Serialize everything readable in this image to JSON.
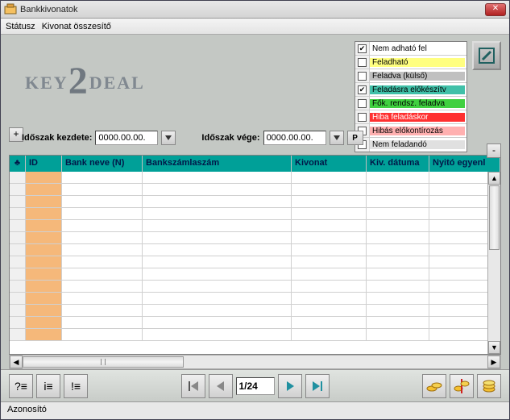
{
  "window": {
    "title": "Bankkivonatok"
  },
  "menu": {
    "status": "Státusz",
    "summary": "Kivonat összesítő"
  },
  "logo": {
    "left": "KEY",
    "mid": "2",
    "right": "DEAL"
  },
  "status_rows": [
    {
      "checked": true,
      "label": "Nem adható fel",
      "bg": "#ffffff"
    },
    {
      "checked": false,
      "label": "Feladható",
      "bg": "#ffff80"
    },
    {
      "checked": false,
      "label": "Feladva (külső)",
      "bg": "#c0c0c0"
    },
    {
      "checked": true,
      "label": "Feladásra előkészítv",
      "bg": "#40c0a8"
    },
    {
      "checked": false,
      "label": "Fők. rendsz. feladva",
      "bg": "#40d040"
    },
    {
      "checked": false,
      "label": "Hiba feladáskor",
      "bg": "#ff3030",
      "fg": "#fff"
    },
    {
      "checked": false,
      "label": "Hibás előkontírozás",
      "bg": "#ffb0b0"
    },
    {
      "checked": false,
      "label": "Nem feladandó",
      "bg": "#e0e0e0"
    }
  ],
  "dates": {
    "start_label": "Időszak kezdete:",
    "start_value": "0000.00.00.",
    "end_label": "Időszak vége:",
    "end_value": "0000.00.00.",
    "p_btn": "P"
  },
  "grid": {
    "columns": [
      "♣",
      "ID",
      "Bank neve (N)",
      "Bankszámlaszám",
      "Kivonat",
      "Kiv. dátuma",
      "Nyitó egyenl"
    ],
    "rows": 14
  },
  "nav": {
    "page": "1/24"
  },
  "statusbar": {
    "text": "Azonosító"
  }
}
